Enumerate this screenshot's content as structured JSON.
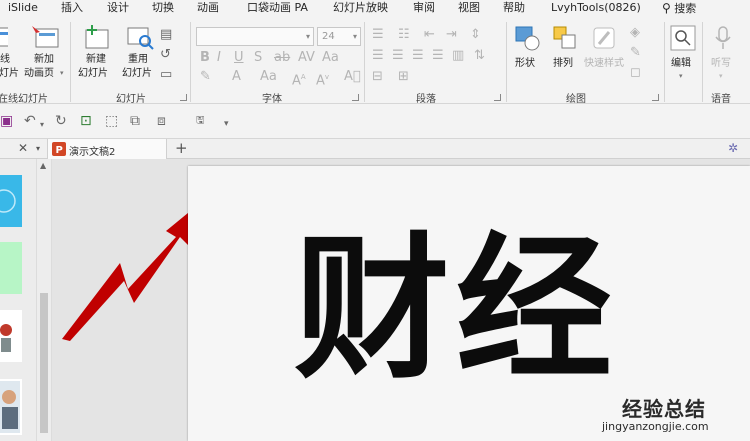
{
  "menu": {
    "tabs": [
      "iSlide",
      "插入",
      "设计",
      "切换",
      "动画",
      "口袋动画 PA",
      "幻灯片放映",
      "审阅",
      "视图",
      "帮助",
      "LvyhTools(0826)"
    ],
    "search_label": "搜索"
  },
  "ribbon": {
    "online_slides": {
      "label_top": "线",
      "label_bottom": "灯片",
      "group": "在线幻灯片"
    },
    "new_page": {
      "label_top": "新加",
      "label_bottom": "动画页"
    },
    "new_slide": {
      "label_top": "新建",
      "label_bottom": "幻灯片"
    },
    "reuse_slide": {
      "label_top": "重用",
      "label_bottom": "幻灯片"
    },
    "slides_group": "幻灯片",
    "font_size_value": "24",
    "font_group": "字体",
    "paragraph_group": "段落",
    "shape": {
      "label": "形状"
    },
    "arrange": {
      "label": "排列"
    },
    "quick_styles": {
      "label": "快速样式"
    },
    "drawing_group": "绘图",
    "edit": {
      "label": "编辑"
    },
    "dictate": {
      "label": "听写"
    },
    "voice_group": "语音"
  },
  "document_tab": {
    "title": "演示文稿2"
  },
  "slide": {
    "title": "财经"
  },
  "watermark": {
    "text": "经验总结",
    "url": "jingyanzongjie.com"
  },
  "colors": {
    "accent_red": "#c00000",
    "ppt_orange": "#d24726",
    "ribbon_bg": "#f3f3f3"
  }
}
